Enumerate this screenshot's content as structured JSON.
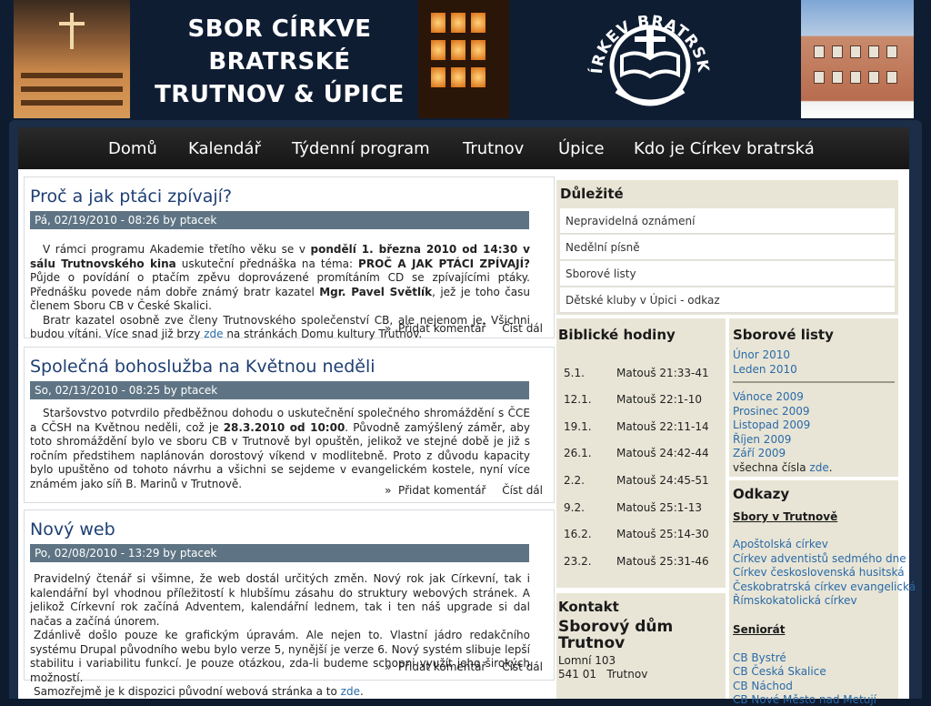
{
  "header": {
    "title_lines": [
      "SBOR CÍRKVE",
      "BRATRSKÉ",
      "TRUTNOV & ÚPICE"
    ],
    "logo_text": "CÍRKEV BRATRSKÁ"
  },
  "nav": {
    "items": [
      "Domů",
      "Kalendář",
      "Týdenní program",
      "Trutnov",
      "Úpice",
      "Kdo je Církev bratrská"
    ]
  },
  "nodes": [
    {
      "title": "Proč a jak ptáci zpívají?",
      "meta": "Pá, 02/19/2010 - 08:26 by ptacek",
      "p1_a": "V rámci programu Akademie třetího věku se v ",
      "p1_b": "pondělí 1. března 2010 od 14:30 v sálu Trutnovského kina",
      "p1_c": " uskuteční přednáška na téma: ",
      "p1_d": "PROČ A JAK PTÁCI ZPÍVAJÍ?",
      "p1_e": " Půjde o povídání o ptačím zpěvu doprovázené promítáním CD se zpívajícími ptáky. Přednášku povede nám dobře známý bratr kazatel ",
      "p1_f": "Mgr. Pavel Světlík",
      "p1_g": ", jež je toho času členem Sboru CB v České Skalici.",
      "p2_a": "Bratr kazatel osobně zve členy Trutnovského společenství CB, ale nejenom je. Všichni budou vítáni. Více snad již brzy ",
      "p2_link": "zde",
      "p2_b": " na stránkách Domu kultury Trutnov.",
      "link_comment": "Přidat komentář",
      "link_more": "Číst dál"
    },
    {
      "title": "Společná bohoslužba na Květnou neděli",
      "meta": "So, 02/13/2010 - 08:25 by ptacek",
      "p1_a": "Staršovstvo potvrdilo předběžnou dohodu o uskutečnění společného shromáždění s ČCE a CČSH na Květnou neděli, což je ",
      "p1_b": "28.3.2010 od 10:00",
      "p1_c": ". Původně zamýšlený záměr, aby toto shromáždění bylo ve sboru CB v Trutnově byl opuštěn, jelikož ve stejné době je již s ročním předstihem naplánován dorostový víkend v modlitebně. Proto z důvodu kapacity bylo upuštěno od tohoto návrhu a všichni se sejdeme v evangelickém kostele, nyní více známém jako síň B. Marinů v Trutnově.",
      "link_comment": "Přidat komentář",
      "link_more": "Číst dál"
    },
    {
      "title": "Nový web",
      "meta": "Po, 02/08/2010 - 13:29 by ptacek",
      "p1": "Pravidelný čtenář si všimne, že web dostál určitých změn. Nový rok jak Církevní, tak i kalendářní byl vhodnou příležitostí k hlubšímu zásahu do struktury webových stránek. A jelikož Církevní rok začíná Adventem, kalendářní lednem, tak i ten náš upgrade si dal načas a začíná únorem.",
      "p2": "Zdánlivě došlo pouze ke grafickým úpravám. Ale nejen to. Vlastní jádro redakčního systému Drupal původního webu bylo verze 5, nynější je verze 6. Nový systém slibuje lepší stabilitu i variabilitu funkcí. Je pouze otázkou, zda-li budeme schopni využít jeho širokých možností.",
      "p3_a": "Samozřejmě je k dispozici původní webová stránka a to ",
      "p3_link": "zde",
      "p3_b": ".",
      "link_comment": "Přidat komentář",
      "link_more": "Číst dál"
    }
  ],
  "sidebar": {
    "important": {
      "title": "Důležité",
      "items": [
        "Nepravidelná oznámení",
        "Nedělní písně",
        "Sborové listy",
        "Dětské kluby v Úpici - odkaz"
      ]
    },
    "bible": {
      "title": "Biblické hodiny",
      "rows": [
        {
          "date": "5.1.",
          "text": "Matouš 21:33-41"
        },
        {
          "date": "12.1.",
          "text": "Matouš 22:1-10"
        },
        {
          "date": "19.1.",
          "text": "Matouš 22:11-14"
        },
        {
          "date": "26.1.",
          "text": "Matouš 24:42-44"
        },
        {
          "date": "2.2.",
          "text": "Matouš 24:45-51"
        },
        {
          "date": "9.2.",
          "text": "Matouš 25:1-13"
        },
        {
          "date": "16.2.",
          "text": "Matouš 25:14-30"
        },
        {
          "date": "23.2.",
          "text": "Matouš 25:31-46"
        }
      ]
    },
    "listy": {
      "title": "Sborové listy",
      "recent": [
        "Únor 2010",
        "Leden 2010"
      ],
      "older": [
        "Vánoce 2009",
        "Prosinec 2009",
        "Listopad 2009",
        "Říjen 2009",
        "Září 2009"
      ],
      "all_text": "všechna čísla ",
      "all_link": "zde",
      "all_end": "."
    },
    "odkazy": {
      "title": "Odkazy",
      "sub1": "Sbory v Trutnově",
      "links1": [
        "Apoštolská církev",
        "Církev adventistů sedmého dne",
        "Církev československá husitská",
        "Českobratrská církev evangelická",
        "Římskokatolická církev"
      ],
      "sub2": "Seniorát",
      "links2": [
        "CB Bystré",
        "CB Česká Skalice",
        "CB Náchod",
        "CB Nové Město nad Metují"
      ]
    },
    "kontakt": {
      "title": "Kontakt",
      "heading": "Sborový dům Trutnov",
      "street": "Lomní 103",
      "city": "541 01   Trutnov"
    }
  },
  "colors": {
    "header_bg": "#0f1d33",
    "nav_bg": "#1b1b1b",
    "meta_bar": "#5e7484",
    "title_blue": "#1e3f73",
    "link_blue": "#2a6aa8",
    "sidebar_block": "#e8e5d6"
  }
}
